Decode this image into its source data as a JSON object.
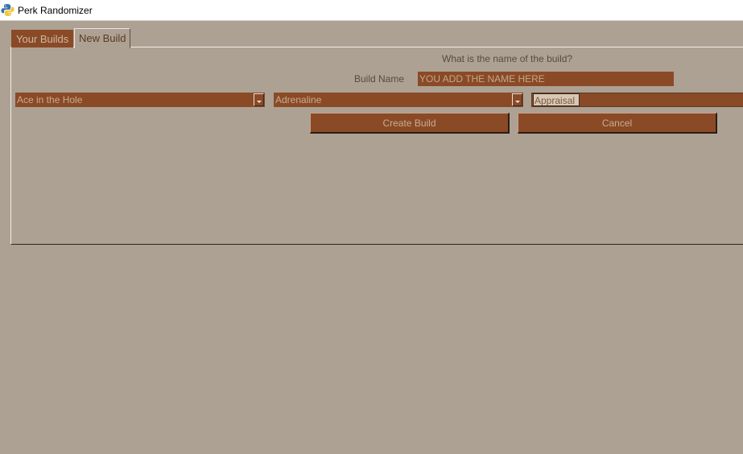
{
  "window": {
    "title": "Perk Randomizer",
    "icon": "python-icon"
  },
  "tabs": [
    {
      "label": "Your Builds",
      "active": false
    },
    {
      "label": "New Build",
      "active": true
    }
  ],
  "form": {
    "question": "What is the name of the build?",
    "name_label": "Build Name",
    "name_value": "YOU ADD THE NAME HERE"
  },
  "perks": [
    {
      "selected": "Ace in the Hole"
    },
    {
      "selected": "Adrenaline"
    },
    {
      "selected": "Appraisal"
    }
  ],
  "buttons": {
    "create": "Create Build",
    "cancel": "Cancel"
  },
  "colors": {
    "background": "#ada194",
    "accent": "#8a4a26",
    "text_on_accent": "#c9ab95",
    "label_text": "#5a4a3c"
  }
}
